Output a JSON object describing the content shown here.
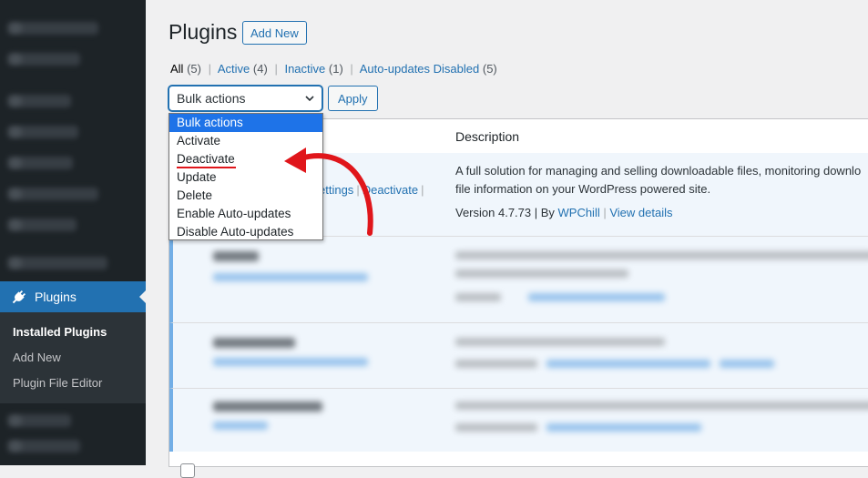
{
  "sidebar": {
    "active_item": "Plugins",
    "submenu": [
      "Installed Plugins",
      "Add New",
      "Plugin File Editor"
    ]
  },
  "header": {
    "title": "Plugins",
    "add_new_label": "Add New"
  },
  "filters": [
    {
      "label": "All",
      "count": "(5)"
    },
    {
      "label": "Active",
      "count": "(4)"
    },
    {
      "label": "Inactive",
      "count": "(1)"
    },
    {
      "label": "Auto-updates Disabled",
      "count": "(5)"
    }
  ],
  "bulk": {
    "selected": "Bulk actions",
    "apply_label": "Apply",
    "options": [
      "Bulk actions",
      "Activate",
      "Deactivate",
      "Update",
      "Delete",
      "Enable Auto-updates",
      "Disable Auto-updates"
    ]
  },
  "table": {
    "col_description": "Description",
    "row1": {
      "actions": [
        "ettings",
        "Deactivate"
      ],
      "desc_line1": "A full solution for managing and selling downloadable files, monitoring downlo",
      "desc_line2": "file information on your WordPress powered site.",
      "version": "Version 4.7.73 | By ",
      "author": "WPChill",
      "sep": " | ",
      "view_details": "View details"
    }
  },
  "colors": {
    "accent": "#2271b1",
    "sidebar_bg": "#1d2327",
    "highlight": "#e0161b",
    "selected_option": "#1e73e8"
  }
}
